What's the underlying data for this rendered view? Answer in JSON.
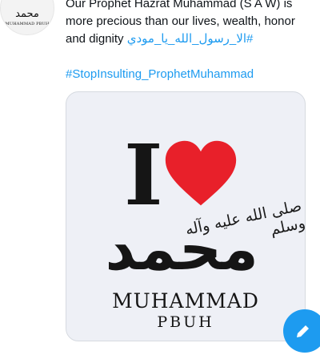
{
  "account": {
    "avatar_mark": "محمد",
    "avatar_label": "MUHAMMAD PBUH"
  },
  "tweet": {
    "text_line_1": "Our Prophet Hazrat Muhammad (S A W) is",
    "text_line_2": "more precious than our lives, wealth, honor",
    "text_line_3_prefix": "and dignity ",
    "hashtag_1": "#الا_رسول_الله_یا_مودي",
    "hashtag_2": "#StopInsulting_ProphetMuhammad",
    "hashtag_color": "#1d9bf0"
  },
  "media": {
    "letter": "I",
    "heart_icon": "red-heart",
    "heart_color": "#e8202a",
    "calligraphy_blessing": "صلى الله عليه وآله وسلم",
    "calligraphy_name": "محمد",
    "caption_name": "MUHAMMAD",
    "caption_suffix": "PBUH"
  },
  "compose_button": {
    "icon": "compose-icon",
    "color": "#1d9bf0"
  }
}
